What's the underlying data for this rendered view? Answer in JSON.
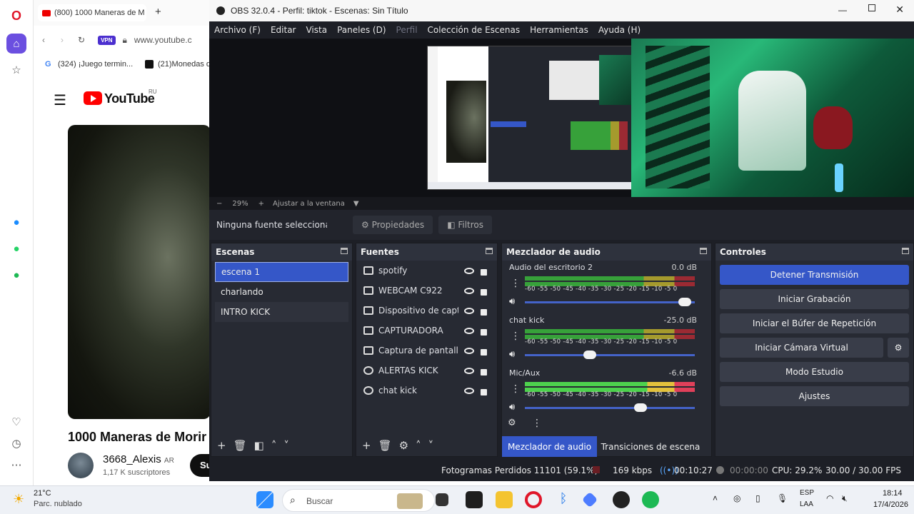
{
  "browser": {
    "tab_title": "(800) 1000 Maneras de M",
    "vpn_badge": "VPN",
    "url": "www.youtube.c",
    "bookmarks": [
      "(324) ¡Juego termin...",
      "(21)Monedas d"
    ],
    "youtube": {
      "logo_text": "YouTube",
      "region": "RU",
      "video_title": "1000 Maneras de Morir",
      "channel": "3668_Alexis",
      "channel_suffix": "AR",
      "subscribers": "1,17 K suscriptores",
      "subscribe_label": "Su"
    }
  },
  "obs": {
    "title": "OBS 32.0.4 - Perfil: tiktok - Escenas: Sin Título",
    "menu": [
      "Archivo (F)",
      "Editar",
      "Vista",
      "Paneles (D)",
      "Perfil",
      "Colección de Escenas",
      "Herramientas",
      "Ayuda (H)"
    ],
    "zoom": {
      "minus": "−",
      "value": "29%",
      "plus": "+",
      "fit_label": "Ajustar a la ventana"
    },
    "source_bar": {
      "selected": "Ninguna fuente seleccionad",
      "properties": "Propiedades",
      "filters": "Filtros"
    },
    "scenes": {
      "title": "Escenas",
      "items": [
        "escena 1",
        "charlando",
        "INTRO KICK"
      ],
      "active_index": 0
    },
    "sources": {
      "title": "Fuentes",
      "items": [
        {
          "name": "spotify",
          "icon": "window-capture-icon"
        },
        {
          "name": "WEBCAM C922",
          "icon": "camera-icon"
        },
        {
          "name": "Dispositivo de captu",
          "icon": "camera-icon"
        },
        {
          "name": "CAPTURADORA",
          "icon": "window-capture-icon"
        },
        {
          "name": "Captura de pantalla",
          "icon": "display-capture-icon"
        },
        {
          "name": "ALERTAS KICK",
          "icon": "browser-icon"
        },
        {
          "name": "chat kick",
          "icon": "browser-icon"
        }
      ]
    },
    "mixer": {
      "title": "Mezclador de audio",
      "ticks": "-60 -55 -50 -45 -40 -35 -30 -25 -20 -15 -10 -5 0",
      "channels": [
        {
          "name": "Audio del escritorio 2",
          "db": "0.0 dB",
          "level": 0.98
        },
        {
          "name": "chat kick",
          "db": "-25.0 dB",
          "level": 0.42
        },
        {
          "name": "Mic/Aux",
          "db": "-6.6 dB",
          "level": 0.72
        }
      ],
      "tab_active": "Mezclador de audio",
      "tab_other": "Transiciones de escena"
    },
    "controls": {
      "title": "Controles",
      "stop_stream": "Detener Transmisión",
      "start_record": "Iniciar Grabación",
      "replay_buffer": "Iniciar el Búfer de Repetición",
      "virtual_cam": "Iniciar Cámara Virtual",
      "studio_mode": "Modo Estudio",
      "settings": "Ajustes"
    },
    "status": {
      "dropped": "Fotogramas Perdidos 11101 (59.1%)",
      "bitrate": "169 kbps",
      "stream_time": "00:10:27",
      "rec_time": "00:00:00",
      "cpu": "CPU: 29.2%",
      "fps": "30.00 / 30.00 FPS"
    }
  },
  "taskbar": {
    "weather_temp": "21°C",
    "weather_desc": "Parc. nublado",
    "search_placeholder": "Buscar",
    "lang_top": "ESP",
    "lang_bottom": "LAA",
    "time": "18:14",
    "date": "17/4/2026"
  },
  "colors": {
    "obs_bg": "#1d1f26",
    "accent": "#3557c8",
    "opera": "#e0172a"
  }
}
